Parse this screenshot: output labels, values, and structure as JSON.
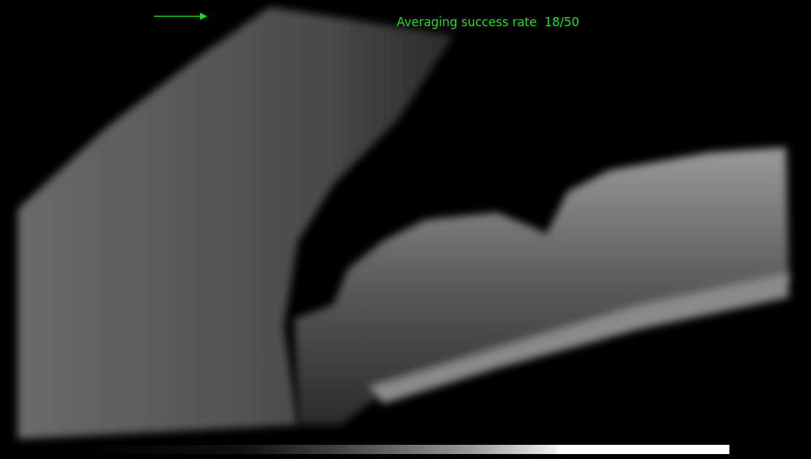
{
  "overlay": {
    "text": "Averaging success rate  18/50"
  }
}
